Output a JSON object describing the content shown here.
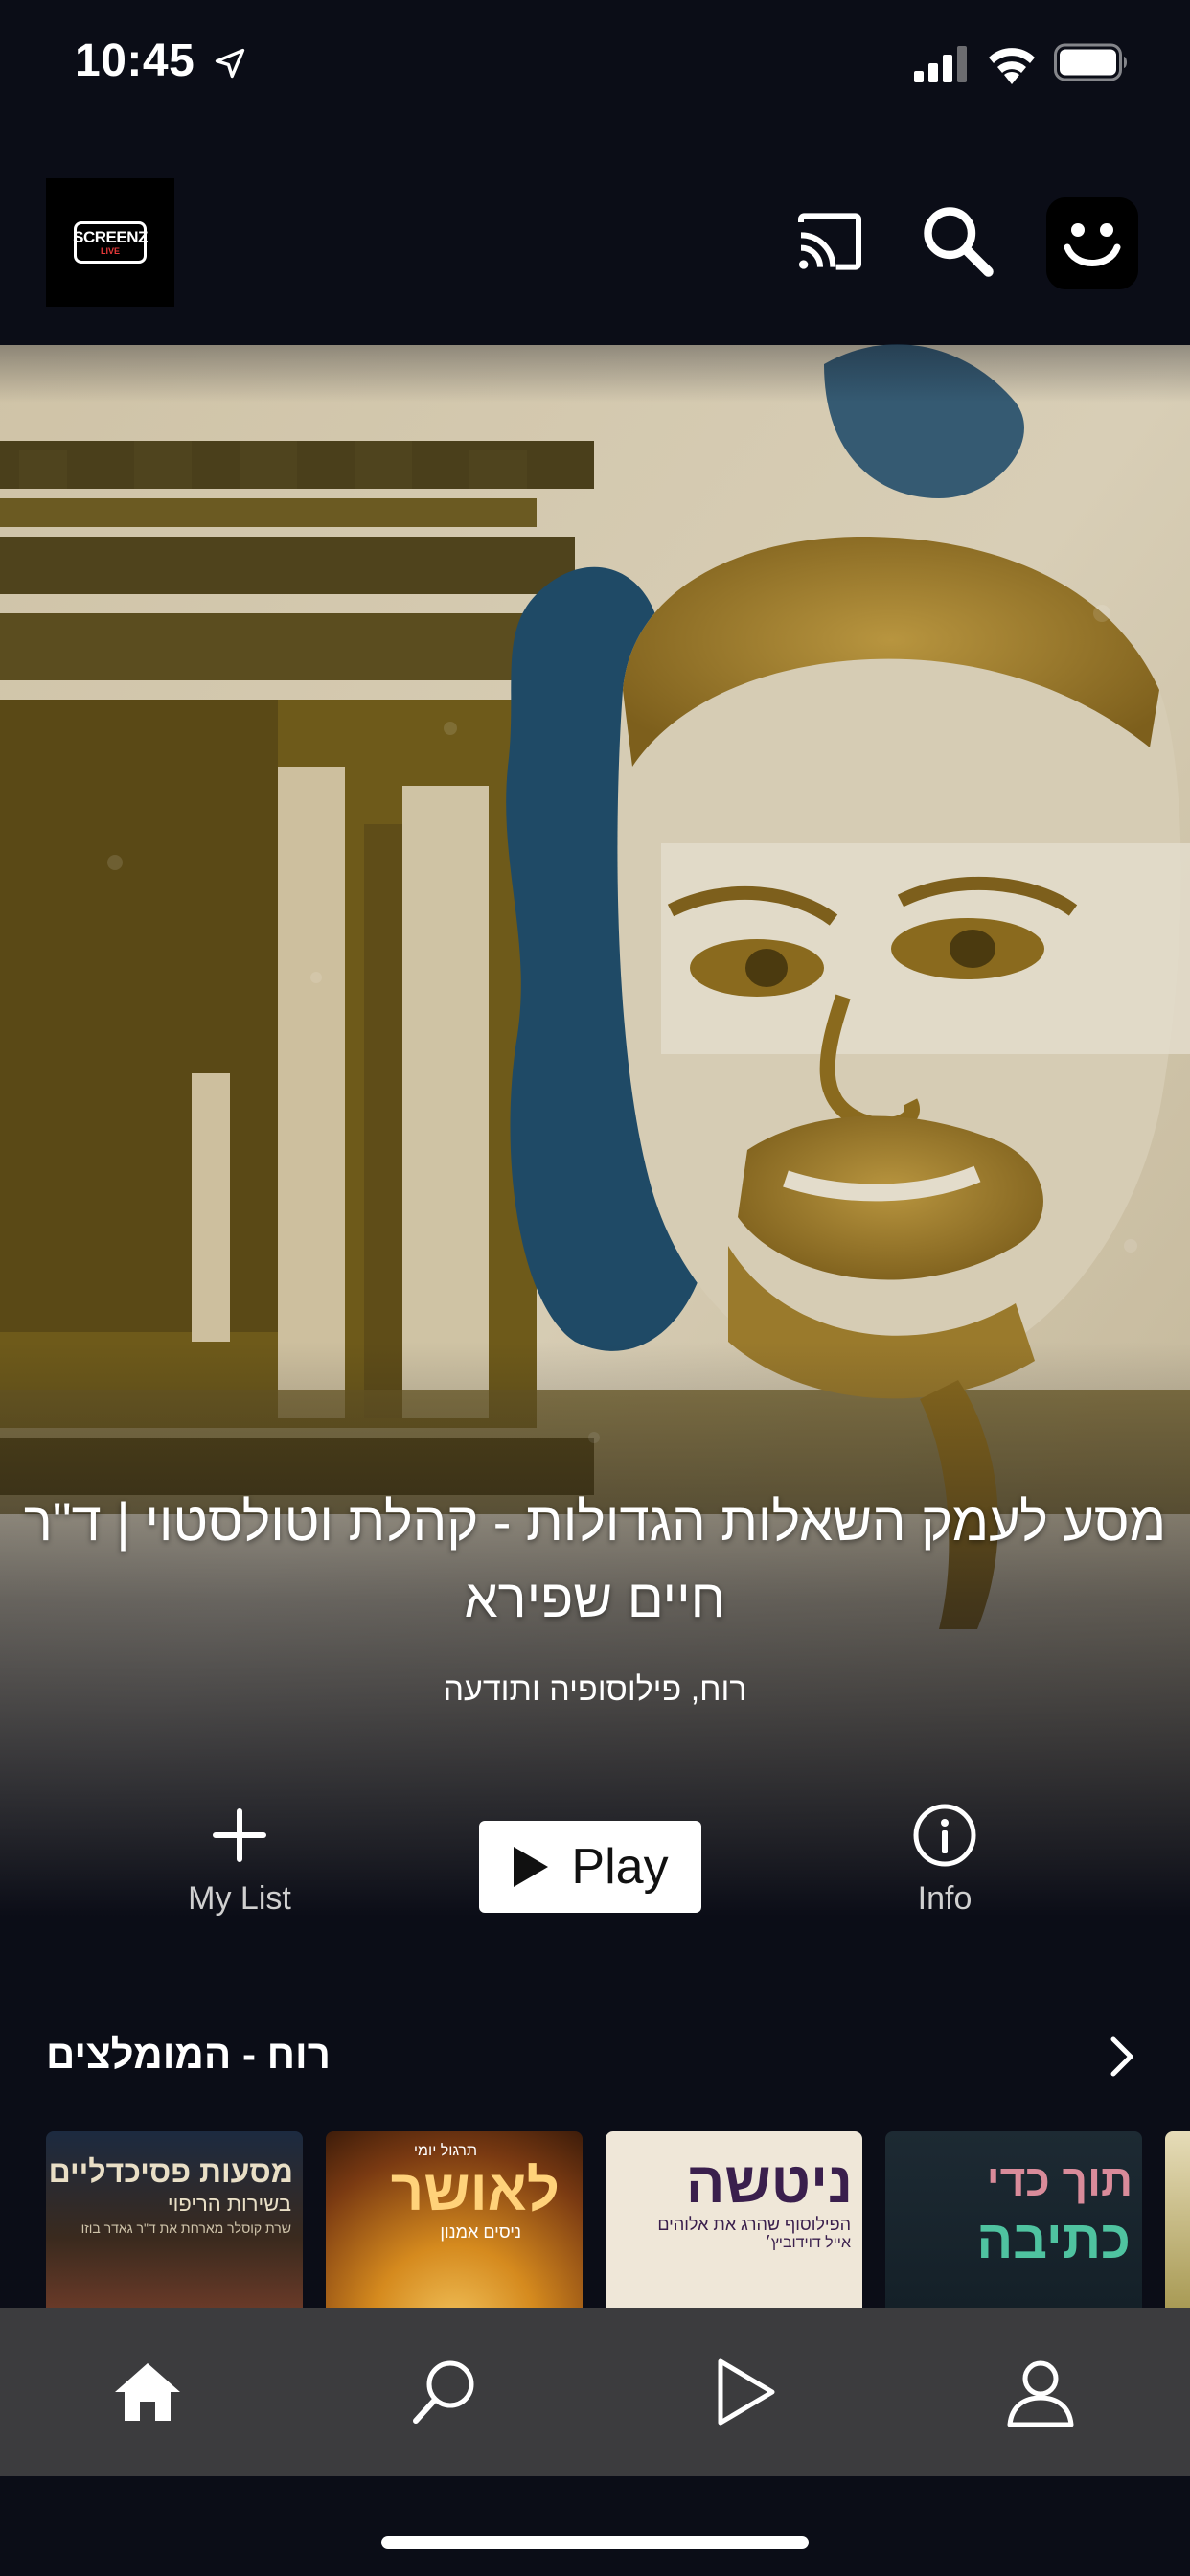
{
  "status_bar": {
    "time": "10:45",
    "icons": [
      "location-arrow-icon",
      "cellular-signal-icon",
      "wifi-icon",
      "battery-icon"
    ]
  },
  "header": {
    "logo_text": "SCREENZ",
    "logo_subtext": "LIVE",
    "icons": [
      "cast-icon",
      "search-icon",
      "profile-smiley-icon"
    ]
  },
  "hero": {
    "title": "מסע לעמק השאלות הגדולות - קהלת וטולסטוי | ד\"ר חיים שפירא",
    "genres": "רוח, פילוסופיה ותודעה",
    "my_list_label": "My List",
    "play_label": "Play",
    "info_label": "Info"
  },
  "row": {
    "title": "רוח - המומלצים",
    "items": [
      {
        "title": "מסעות פסיכדליים",
        "subtitle": "בשירות הריפוי",
        "caption": "שרת קוסלר מארחת את ד\"ר גאדר בוזו"
      },
      {
        "title": "לאושר",
        "subtitle": "ניסים אמנון",
        "caption": "תרגול יומי"
      },
      {
        "title": "ניטשה",
        "subtitle": "הפילוסוף שהרג את אלוהים",
        "caption": "אייל דוידוביץ׳"
      },
      {
        "title": "תוך כדי",
        "subtitle": "כתיבה",
        "caption": ""
      }
    ]
  },
  "tab_bar": {
    "tabs": [
      "home-icon",
      "search-icon",
      "play-icon",
      "profile-icon"
    ],
    "active": "home-icon"
  },
  "colors": {
    "background": "#0b0d17",
    "tab_bar": "#3c3c3e",
    "hero_gold": "#8a6a1e",
    "hero_blue": "#1f4a66",
    "play_button": "#ffffff"
  }
}
